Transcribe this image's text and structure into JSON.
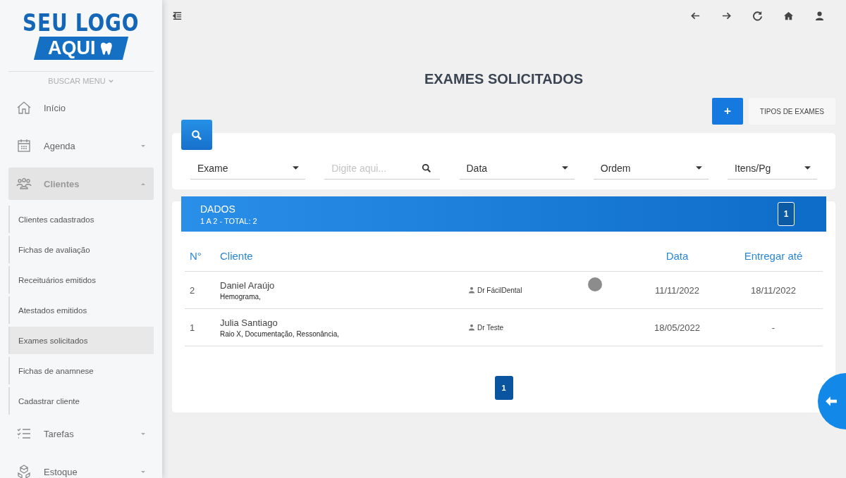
{
  "logo": {
    "line_1": "SEU LOGO",
    "line_2": "AQUI"
  },
  "sidebar": {
    "search_menu": "BUSCAR MENU",
    "items": [
      {
        "label": "Início",
        "expandable": false,
        "expanded": false
      },
      {
        "label": "Agenda",
        "expandable": true,
        "expanded": false
      },
      {
        "label": "Clientes",
        "expandable": true,
        "expanded": true,
        "children": [
          {
            "label": "Clientes cadastrados",
            "selected": false
          },
          {
            "label": "Fichas de avaliação",
            "selected": false
          },
          {
            "label": "Receituários emitidos",
            "selected": false
          },
          {
            "label": "Atestados emitidos",
            "selected": false
          },
          {
            "label": "Exames solicitados",
            "selected": true
          },
          {
            "label": "Fichas de anamnese",
            "selected": false
          },
          {
            "label": "Cadastrar cliente",
            "selected": false
          }
        ]
      },
      {
        "label": "Tarefas",
        "expandable": true,
        "expanded": false
      },
      {
        "label": "Estoque",
        "expandable": true,
        "expanded": false
      }
    ]
  },
  "page": {
    "title": "EXAMES SOLICITADOS",
    "add_button": "+",
    "types_button": "TIPOS DE EXAMES"
  },
  "filters": [
    {
      "kind": "select",
      "label": "Exame"
    },
    {
      "kind": "search",
      "placeholder": "Digite aqui..."
    },
    {
      "kind": "select",
      "label": "Data"
    },
    {
      "kind": "select",
      "label": "Ordem"
    },
    {
      "kind": "select",
      "label": "Itens/Pg"
    }
  ],
  "data_header": {
    "title": "DADOS",
    "summary": "1 A 2 - TOTAL: 2",
    "page": "1"
  },
  "table": {
    "columns": [
      "N°",
      "Cliente",
      "Data",
      "Entregar até"
    ],
    "rows": [
      {
        "number": "2",
        "client": "Daniel Araújo",
        "exams": "Hemograma,",
        "doctor": "Dr FácilDental",
        "status_dot": true,
        "date": "11/11/2022",
        "deliver_by": "18/11/2022"
      },
      {
        "number": "1",
        "client": "Julia Santiago",
        "exams": "Raio X, Documentação, Ressonância,",
        "doctor": "Dr Teste",
        "status_dot": false,
        "date": "18/05/2022",
        "deliver_by": "-"
      }
    ]
  },
  "pagination": [
    {
      "label": "1",
      "selected": true
    }
  ]
}
